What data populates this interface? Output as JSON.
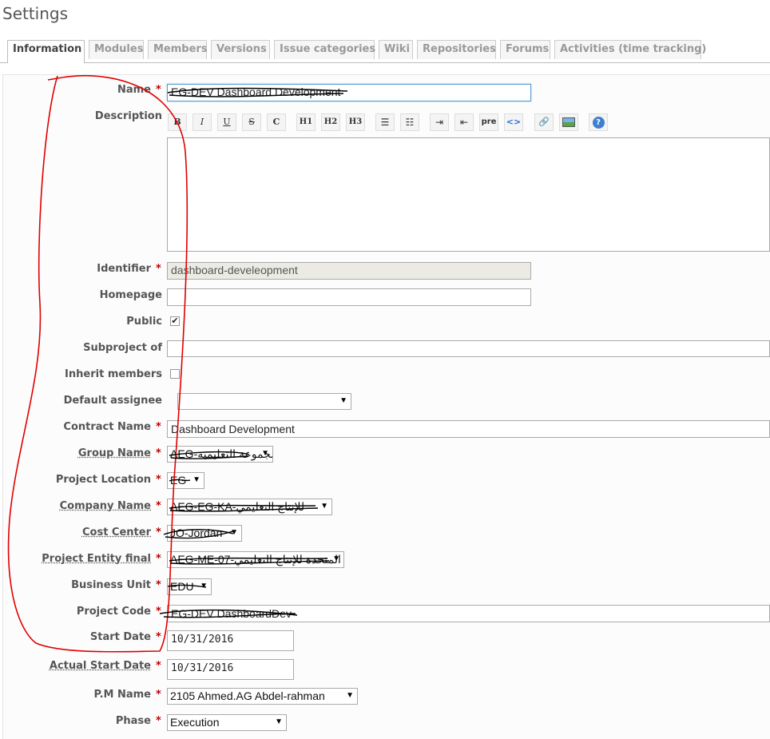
{
  "page": {
    "title": "Settings"
  },
  "tabs": [
    {
      "label": "Information",
      "active": true
    },
    {
      "label": "Modules"
    },
    {
      "label": "Members"
    },
    {
      "label": "Versions"
    },
    {
      "label": "Issue categories"
    },
    {
      "label": "Wiki"
    },
    {
      "label": "Repositories"
    },
    {
      "label": "Forums"
    },
    {
      "label": "Activities (time tracking)"
    }
  ],
  "toolbar": {
    "bold": "B",
    "italic": "I",
    "underline": "U",
    "strike": "S",
    "code": "C",
    "h1": "H1",
    "h2": "H2",
    "h3": "H3",
    "pre": "pre",
    "inline_code": "<>",
    "help": "?"
  },
  "form": {
    "name": {
      "label": "Name",
      "value": "EG-DEV Dashboard Development"
    },
    "description": {
      "label": "Description",
      "value": ""
    },
    "identifier": {
      "label": "Identifier",
      "value": "dashboard-develeopment"
    },
    "homepage": {
      "label": "Homepage",
      "value": ""
    },
    "public": {
      "label": "Public",
      "checked": true
    },
    "subproject_of": {
      "label": "Subproject of",
      "value": ""
    },
    "inherit_members": {
      "label": "Inherit members",
      "checked": false
    },
    "default_assignee": {
      "label": "Default assignee",
      "value": ""
    },
    "contract_name": {
      "label": "Contract Name",
      "value": "Dashboard Development"
    },
    "group_name": {
      "label": "Group Name",
      "value": "AEG-المجموعة التعليمية"
    },
    "project_location": {
      "label": "Project Location",
      "value": "EG"
    },
    "company_name": {
      "label": "Company Name",
      "value": "AEG-EG-KA-للإنتاج التعليمي"
    },
    "cost_center": {
      "label": "Cost Center",
      "value": "JO-Jordan"
    },
    "project_entity_final": {
      "label": "Project Entity final",
      "value": "AEG-ME-07-المتحدة للإنتاج التعليمي"
    },
    "business_unit": {
      "label": "Business Unit",
      "value": "EDU"
    },
    "project_code": {
      "label": "Project Code",
      "value": "EG-DEV DashboardDev"
    },
    "start_date": {
      "label": "Start Date",
      "value": "10/31/2016"
    },
    "actual_start_date": {
      "label": "Actual Start Date",
      "value": "10/31/2016"
    },
    "pm_name": {
      "label": "P.M Name",
      "value": "2105 Ahmed.AG Abdel-rahman"
    },
    "phase": {
      "label": "Phase",
      "value": "Execution"
    }
  },
  "colors": {
    "required": "#bb0000",
    "annotation": "#e00000",
    "focus": "#5a9bd5"
  }
}
